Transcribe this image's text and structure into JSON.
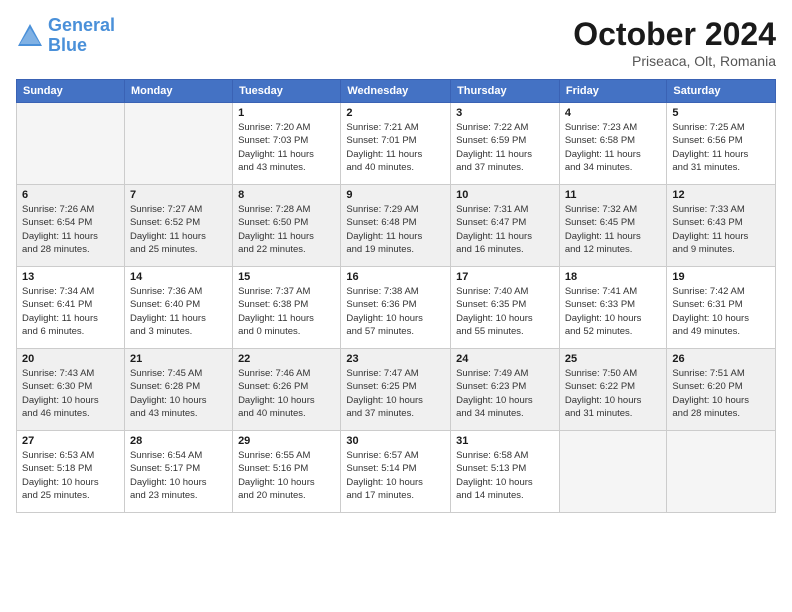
{
  "header": {
    "logo": {
      "line1": "General",
      "line2": "Blue"
    },
    "title": "October 2024",
    "location": "Priseaca, Olt, Romania"
  },
  "weekdays": [
    "Sunday",
    "Monday",
    "Tuesday",
    "Wednesday",
    "Thursday",
    "Friday",
    "Saturday"
  ],
  "weeks": [
    [
      {
        "day": "",
        "empty": true
      },
      {
        "day": "",
        "empty": true
      },
      {
        "day": "1",
        "sunrise": "7:20 AM",
        "sunset": "7:03 PM",
        "daylight": "11 hours and 43 minutes."
      },
      {
        "day": "2",
        "sunrise": "7:21 AM",
        "sunset": "7:01 PM",
        "daylight": "11 hours and 40 minutes."
      },
      {
        "day": "3",
        "sunrise": "7:22 AM",
        "sunset": "6:59 PM",
        "daylight": "11 hours and 37 minutes."
      },
      {
        "day": "4",
        "sunrise": "7:23 AM",
        "sunset": "6:58 PM",
        "daylight": "11 hours and 34 minutes."
      },
      {
        "day": "5",
        "sunrise": "7:25 AM",
        "sunset": "6:56 PM",
        "daylight": "11 hours and 31 minutes."
      }
    ],
    [
      {
        "day": "6",
        "sunrise": "7:26 AM",
        "sunset": "6:54 PM",
        "daylight": "11 hours and 28 minutes."
      },
      {
        "day": "7",
        "sunrise": "7:27 AM",
        "sunset": "6:52 PM",
        "daylight": "11 hours and 25 minutes."
      },
      {
        "day": "8",
        "sunrise": "7:28 AM",
        "sunset": "6:50 PM",
        "daylight": "11 hours and 22 minutes."
      },
      {
        "day": "9",
        "sunrise": "7:29 AM",
        "sunset": "6:48 PM",
        "daylight": "11 hours and 19 minutes."
      },
      {
        "day": "10",
        "sunrise": "7:31 AM",
        "sunset": "6:47 PM",
        "daylight": "11 hours and 16 minutes."
      },
      {
        "day": "11",
        "sunrise": "7:32 AM",
        "sunset": "6:45 PM",
        "daylight": "11 hours and 12 minutes."
      },
      {
        "day": "12",
        "sunrise": "7:33 AM",
        "sunset": "6:43 PM",
        "daylight": "11 hours and 9 minutes."
      }
    ],
    [
      {
        "day": "13",
        "sunrise": "7:34 AM",
        "sunset": "6:41 PM",
        "daylight": "11 hours and 6 minutes."
      },
      {
        "day": "14",
        "sunrise": "7:36 AM",
        "sunset": "6:40 PM",
        "daylight": "11 hours and 3 minutes."
      },
      {
        "day": "15",
        "sunrise": "7:37 AM",
        "sunset": "6:38 PM",
        "daylight": "11 hours and 0 minutes."
      },
      {
        "day": "16",
        "sunrise": "7:38 AM",
        "sunset": "6:36 PM",
        "daylight": "10 hours and 57 minutes."
      },
      {
        "day": "17",
        "sunrise": "7:40 AM",
        "sunset": "6:35 PM",
        "daylight": "10 hours and 55 minutes."
      },
      {
        "day": "18",
        "sunrise": "7:41 AM",
        "sunset": "6:33 PM",
        "daylight": "10 hours and 52 minutes."
      },
      {
        "day": "19",
        "sunrise": "7:42 AM",
        "sunset": "6:31 PM",
        "daylight": "10 hours and 49 minutes."
      }
    ],
    [
      {
        "day": "20",
        "sunrise": "7:43 AM",
        "sunset": "6:30 PM",
        "daylight": "10 hours and 46 minutes."
      },
      {
        "day": "21",
        "sunrise": "7:45 AM",
        "sunset": "6:28 PM",
        "daylight": "10 hours and 43 minutes."
      },
      {
        "day": "22",
        "sunrise": "7:46 AM",
        "sunset": "6:26 PM",
        "daylight": "10 hours and 40 minutes."
      },
      {
        "day": "23",
        "sunrise": "7:47 AM",
        "sunset": "6:25 PM",
        "daylight": "10 hours and 37 minutes."
      },
      {
        "day": "24",
        "sunrise": "7:49 AM",
        "sunset": "6:23 PM",
        "daylight": "10 hours and 34 minutes."
      },
      {
        "day": "25",
        "sunrise": "7:50 AM",
        "sunset": "6:22 PM",
        "daylight": "10 hours and 31 minutes."
      },
      {
        "day": "26",
        "sunrise": "7:51 AM",
        "sunset": "6:20 PM",
        "daylight": "10 hours and 28 minutes."
      }
    ],
    [
      {
        "day": "27",
        "sunrise": "6:53 AM",
        "sunset": "5:18 PM",
        "daylight": "10 hours and 25 minutes."
      },
      {
        "day": "28",
        "sunrise": "6:54 AM",
        "sunset": "5:17 PM",
        "daylight": "10 hours and 23 minutes."
      },
      {
        "day": "29",
        "sunrise": "6:55 AM",
        "sunset": "5:16 PM",
        "daylight": "10 hours and 20 minutes."
      },
      {
        "day": "30",
        "sunrise": "6:57 AM",
        "sunset": "5:14 PM",
        "daylight": "10 hours and 17 minutes."
      },
      {
        "day": "31",
        "sunrise": "6:58 AM",
        "sunset": "5:13 PM",
        "daylight": "10 hours and 14 minutes."
      },
      {
        "day": "",
        "empty": true
      },
      {
        "day": "",
        "empty": true
      }
    ]
  ],
  "colors": {
    "header_bg": "#4472c4",
    "shaded_row": "#f0f0f0"
  }
}
